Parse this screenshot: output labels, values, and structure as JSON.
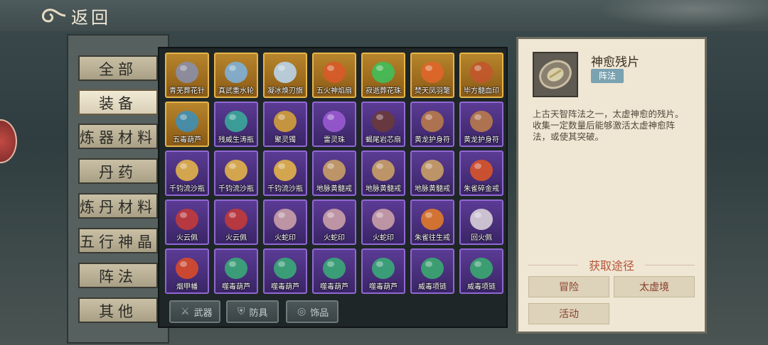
{
  "header": {
    "back_label": "返回",
    "back_icon": "swirl-icon"
  },
  "categories": [
    "全部",
    "装备",
    "炼器材料",
    "丹药",
    "炼丹材料",
    "五行神晶",
    "阵法",
    "其他"
  ],
  "active_category": "装备",
  "items": [
    {
      "name": "青芜葬花针",
      "rarity": "gold",
      "icon": "needle-icon",
      "color": "#8a8fa8"
    },
    {
      "name": "真武重水轮",
      "rarity": "gold",
      "icon": "water-wheel-icon",
      "color": "#7fb0d8"
    },
    {
      "name": "凝冰焕刃旗",
      "rarity": "gold",
      "icon": "ice-flag-icon",
      "color": "#b9d4ea"
    },
    {
      "name": "五火神焰扇",
      "rarity": "gold",
      "icon": "fire-fan-icon",
      "color": "#d85a2a"
    },
    {
      "name": "寂逝葬花珠",
      "rarity": "gold",
      "icon": "jade-orb-icon",
      "color": "#3fbf5a"
    },
    {
      "name": "焚天凤羽氅",
      "rarity": "gold",
      "icon": "phoenix-icon",
      "color": "#e0662a"
    },
    {
      "name": "毕方髓血印",
      "rarity": "gold",
      "icon": "seal-icon",
      "color": "#c2572c"
    },
    {
      "name": "五毒葫芦",
      "rarity": "gold",
      "icon": "gourd-icon",
      "color": "#3f8fb5"
    },
    {
      "name": "残威生涛瓶",
      "rarity": "purple",
      "icon": "vase-icon",
      "color": "#3aa89a"
    },
    {
      "name": "聚灵镯",
      "rarity": "purple",
      "icon": "bracelet-icon",
      "color": "#d2a03a"
    },
    {
      "name": "雷灵珠",
      "rarity": "purple",
      "icon": "thunder-orb-icon",
      "color": "#9a5ad2"
    },
    {
      "name": "蝎尾岩芯扇",
      "rarity": "purple",
      "icon": "dark-fan-icon",
      "color": "#6a3a3a"
    },
    {
      "name": "黄龙护身符",
      "rarity": "purple",
      "icon": "amulet-icon",
      "color": "#b87a4a"
    },
    {
      "name": "黄龙护身符",
      "rarity": "purple",
      "icon": "amulet-icon",
      "color": "#b87a4a"
    },
    {
      "name": "千钧流沙瓶",
      "rarity": "purple",
      "icon": "sand-bottle-icon",
      "color": "#e2b24a"
    },
    {
      "name": "千钧流沙瓶",
      "rarity": "purple",
      "icon": "sand-bottle-icon",
      "color": "#e2b24a"
    },
    {
      "name": "千钧流沙瓶",
      "rarity": "purple",
      "icon": "sand-bottle-icon",
      "color": "#e2b24a"
    },
    {
      "name": "地脉黄髓戒",
      "rarity": "purple",
      "icon": "ring-icon",
      "color": "#c9a066"
    },
    {
      "name": "地脉黄髓戒",
      "rarity": "purple",
      "icon": "ring-icon",
      "color": "#c9a066"
    },
    {
      "name": "地脉黄髓戒",
      "rarity": "purple",
      "icon": "ring-icon",
      "color": "#c9a066"
    },
    {
      "name": "朱雀碎金戒",
      "rarity": "purple",
      "icon": "flame-ring-icon",
      "color": "#d8542a"
    },
    {
      "name": "火云佩",
      "rarity": "purple",
      "icon": "pendant-icon",
      "color": "#c23a3a"
    },
    {
      "name": "火云佩",
      "rarity": "purple",
      "icon": "pendant-icon",
      "color": "#c23a3a"
    },
    {
      "name": "火蛇印",
      "rarity": "purple",
      "icon": "tower-seal-icon",
      "color": "#c9a0a8"
    },
    {
      "name": "火蛇印",
      "rarity": "purple",
      "icon": "tower-seal-icon",
      "color": "#c9a0a8"
    },
    {
      "name": "火蛇印",
      "rarity": "purple",
      "icon": "tower-seal-icon",
      "color": "#c9a0a8"
    },
    {
      "name": "朱雀往生戒",
      "rarity": "purple",
      "icon": "flame-ring-icon",
      "color": "#e07a2a"
    },
    {
      "name": "回火佩",
      "rarity": "purple",
      "icon": "spiral-pendant-icon",
      "color": "#d8d0d8"
    },
    {
      "name": "烟甲幡",
      "rarity": "purple",
      "icon": "banner-icon",
      "color": "#d84a2a"
    },
    {
      "name": "噬毒葫芦",
      "rarity": "purple",
      "icon": "gourd-icon",
      "color": "#3aa878"
    },
    {
      "name": "噬毒葫芦",
      "rarity": "purple",
      "icon": "gourd-icon",
      "color": "#3aa878"
    },
    {
      "name": "噬毒葫芦",
      "rarity": "purple",
      "icon": "gourd-icon",
      "color": "#3aa878"
    },
    {
      "name": "噬毒葫芦",
      "rarity": "purple",
      "icon": "gourd-icon",
      "color": "#3aa878"
    },
    {
      "name": "威毒项链",
      "rarity": "purple",
      "icon": "necklace-icon",
      "color": "#3aa870"
    },
    {
      "name": "威毒项链",
      "rarity": "purple",
      "icon": "necklace-icon",
      "color": "#3aa870"
    }
  ],
  "filters": [
    {
      "label": "武器",
      "icon": "sword-icon"
    },
    {
      "label": "防具",
      "icon": "armor-icon"
    },
    {
      "label": "饰品",
      "icon": "ring-icon"
    }
  ],
  "detail": {
    "name": "神愈残片",
    "tag": "阵法",
    "description": "上古天智阵法之一，太虚神愈的残片。收集一定数量后能够激活太虚神愈阵法，或使其突破。",
    "obtain_title": "获取途径",
    "sources": [
      "冒险",
      "太虚境",
      "活动"
    ]
  },
  "colors": {
    "gold_border": "#e6b54a",
    "purple_border": "#8f68d2",
    "accent": "#b5553a"
  }
}
